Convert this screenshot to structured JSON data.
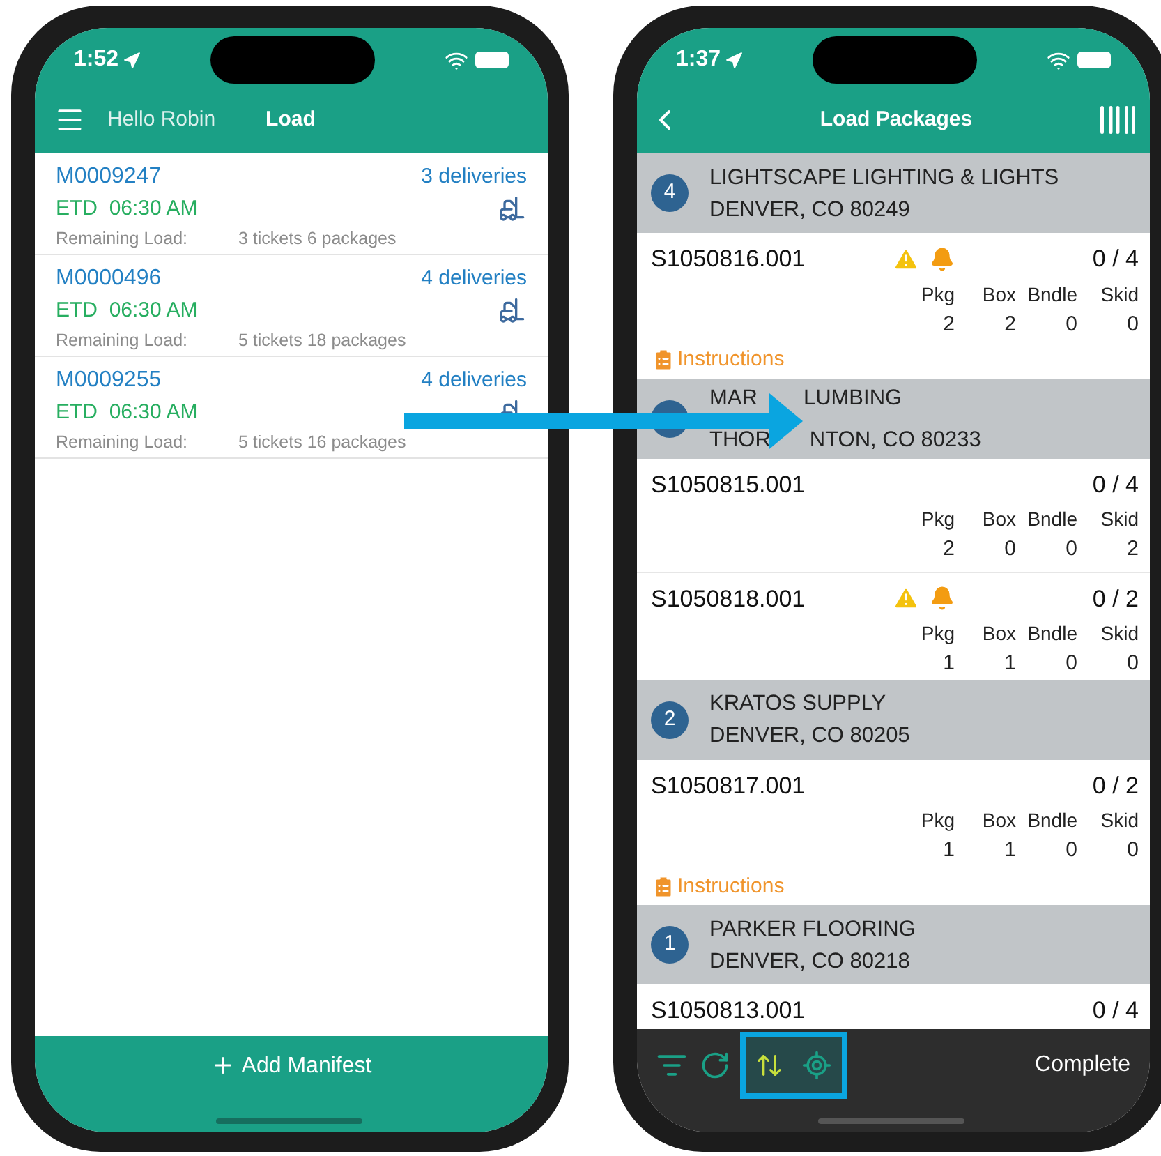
{
  "left": {
    "status_time": "1:52",
    "greeting": "Hello Robin",
    "title": "Load",
    "manifests": [
      {
        "id": "M0009247",
        "deliveries": "3 deliveries",
        "etd_label": "ETD",
        "etd": "06:30 AM",
        "remaining_label": "Remaining Load:",
        "remaining": "3 tickets 6 packages"
      },
      {
        "id": "M0000496",
        "deliveries": "4 deliveries",
        "etd_label": "ETD",
        "etd": "06:30 AM",
        "remaining_label": "Remaining Load:",
        "remaining": "5 tickets 18 packages"
      },
      {
        "id": "M0009255",
        "deliveries": "4 deliveries",
        "etd_label": "ETD",
        "etd": "06:30 AM",
        "remaining_label": "Remaining Load:",
        "remaining": "5 tickets 16 packages"
      }
    ],
    "add_button": "Add Manifest"
  },
  "right": {
    "status_time": "1:37",
    "title": "Load Packages",
    "stops": [
      {
        "number": "4",
        "name": "LIGHTSCAPE LIGHTING & LIGHTS",
        "city": "DENVER, CO 80249",
        "tickets": [
          {
            "id": "S1050816.001",
            "warning": true,
            "alert": true,
            "count": "0 / 4",
            "columns": [
              {
                "label": "Pkg",
                "value": "2"
              },
              {
                "label": "Box",
                "value": "2"
              },
              {
                "label": "Bndle",
                "value": "0"
              },
              {
                "label": "Skid",
                "value": "0"
              }
            ],
            "instructions": "Instructions"
          }
        ]
      },
      {
        "name_parts": [
          "MAR",
          "LUMBING"
        ],
        "city_parts": [
          "THOR",
          "NTON, CO 80233"
        ],
        "tickets": [
          {
            "id": "S1050815.001",
            "warning": false,
            "alert": false,
            "count": "0 / 4",
            "columns": [
              {
                "label": "Pkg",
                "value": "2"
              },
              {
                "label": "Box",
                "value": "0"
              },
              {
                "label": "Bndle",
                "value": "0"
              },
              {
                "label": "Skid",
                "value": "2"
              }
            ]
          },
          {
            "id": "S1050818.001",
            "warning": true,
            "alert": true,
            "count": "0 / 2",
            "columns": [
              {
                "label": "Pkg",
                "value": "1"
              },
              {
                "label": "Box",
                "value": "1"
              },
              {
                "label": "Bndle",
                "value": "0"
              },
              {
                "label": "Skid",
                "value": "0"
              }
            ]
          }
        ]
      },
      {
        "number": "2",
        "name": "KRATOS SUPPLY",
        "city": "DENVER, CO 80205",
        "tickets": [
          {
            "id": "S1050817.001",
            "warning": false,
            "alert": false,
            "count": "0 / 2",
            "columns": [
              {
                "label": "Pkg",
                "value": "1"
              },
              {
                "label": "Box",
                "value": "1"
              },
              {
                "label": "Bndle",
                "value": "0"
              },
              {
                "label": "Skid",
                "value": "0"
              }
            ],
            "instructions": "Instructions"
          }
        ]
      },
      {
        "number": "1",
        "name": "PARKER FLOORING",
        "city": "DENVER, CO 80218",
        "tickets": [
          {
            "id": "S1050813.001",
            "warning": false,
            "alert": false,
            "count": "0 / 4"
          }
        ]
      }
    ],
    "complete_button": "Complete"
  }
}
